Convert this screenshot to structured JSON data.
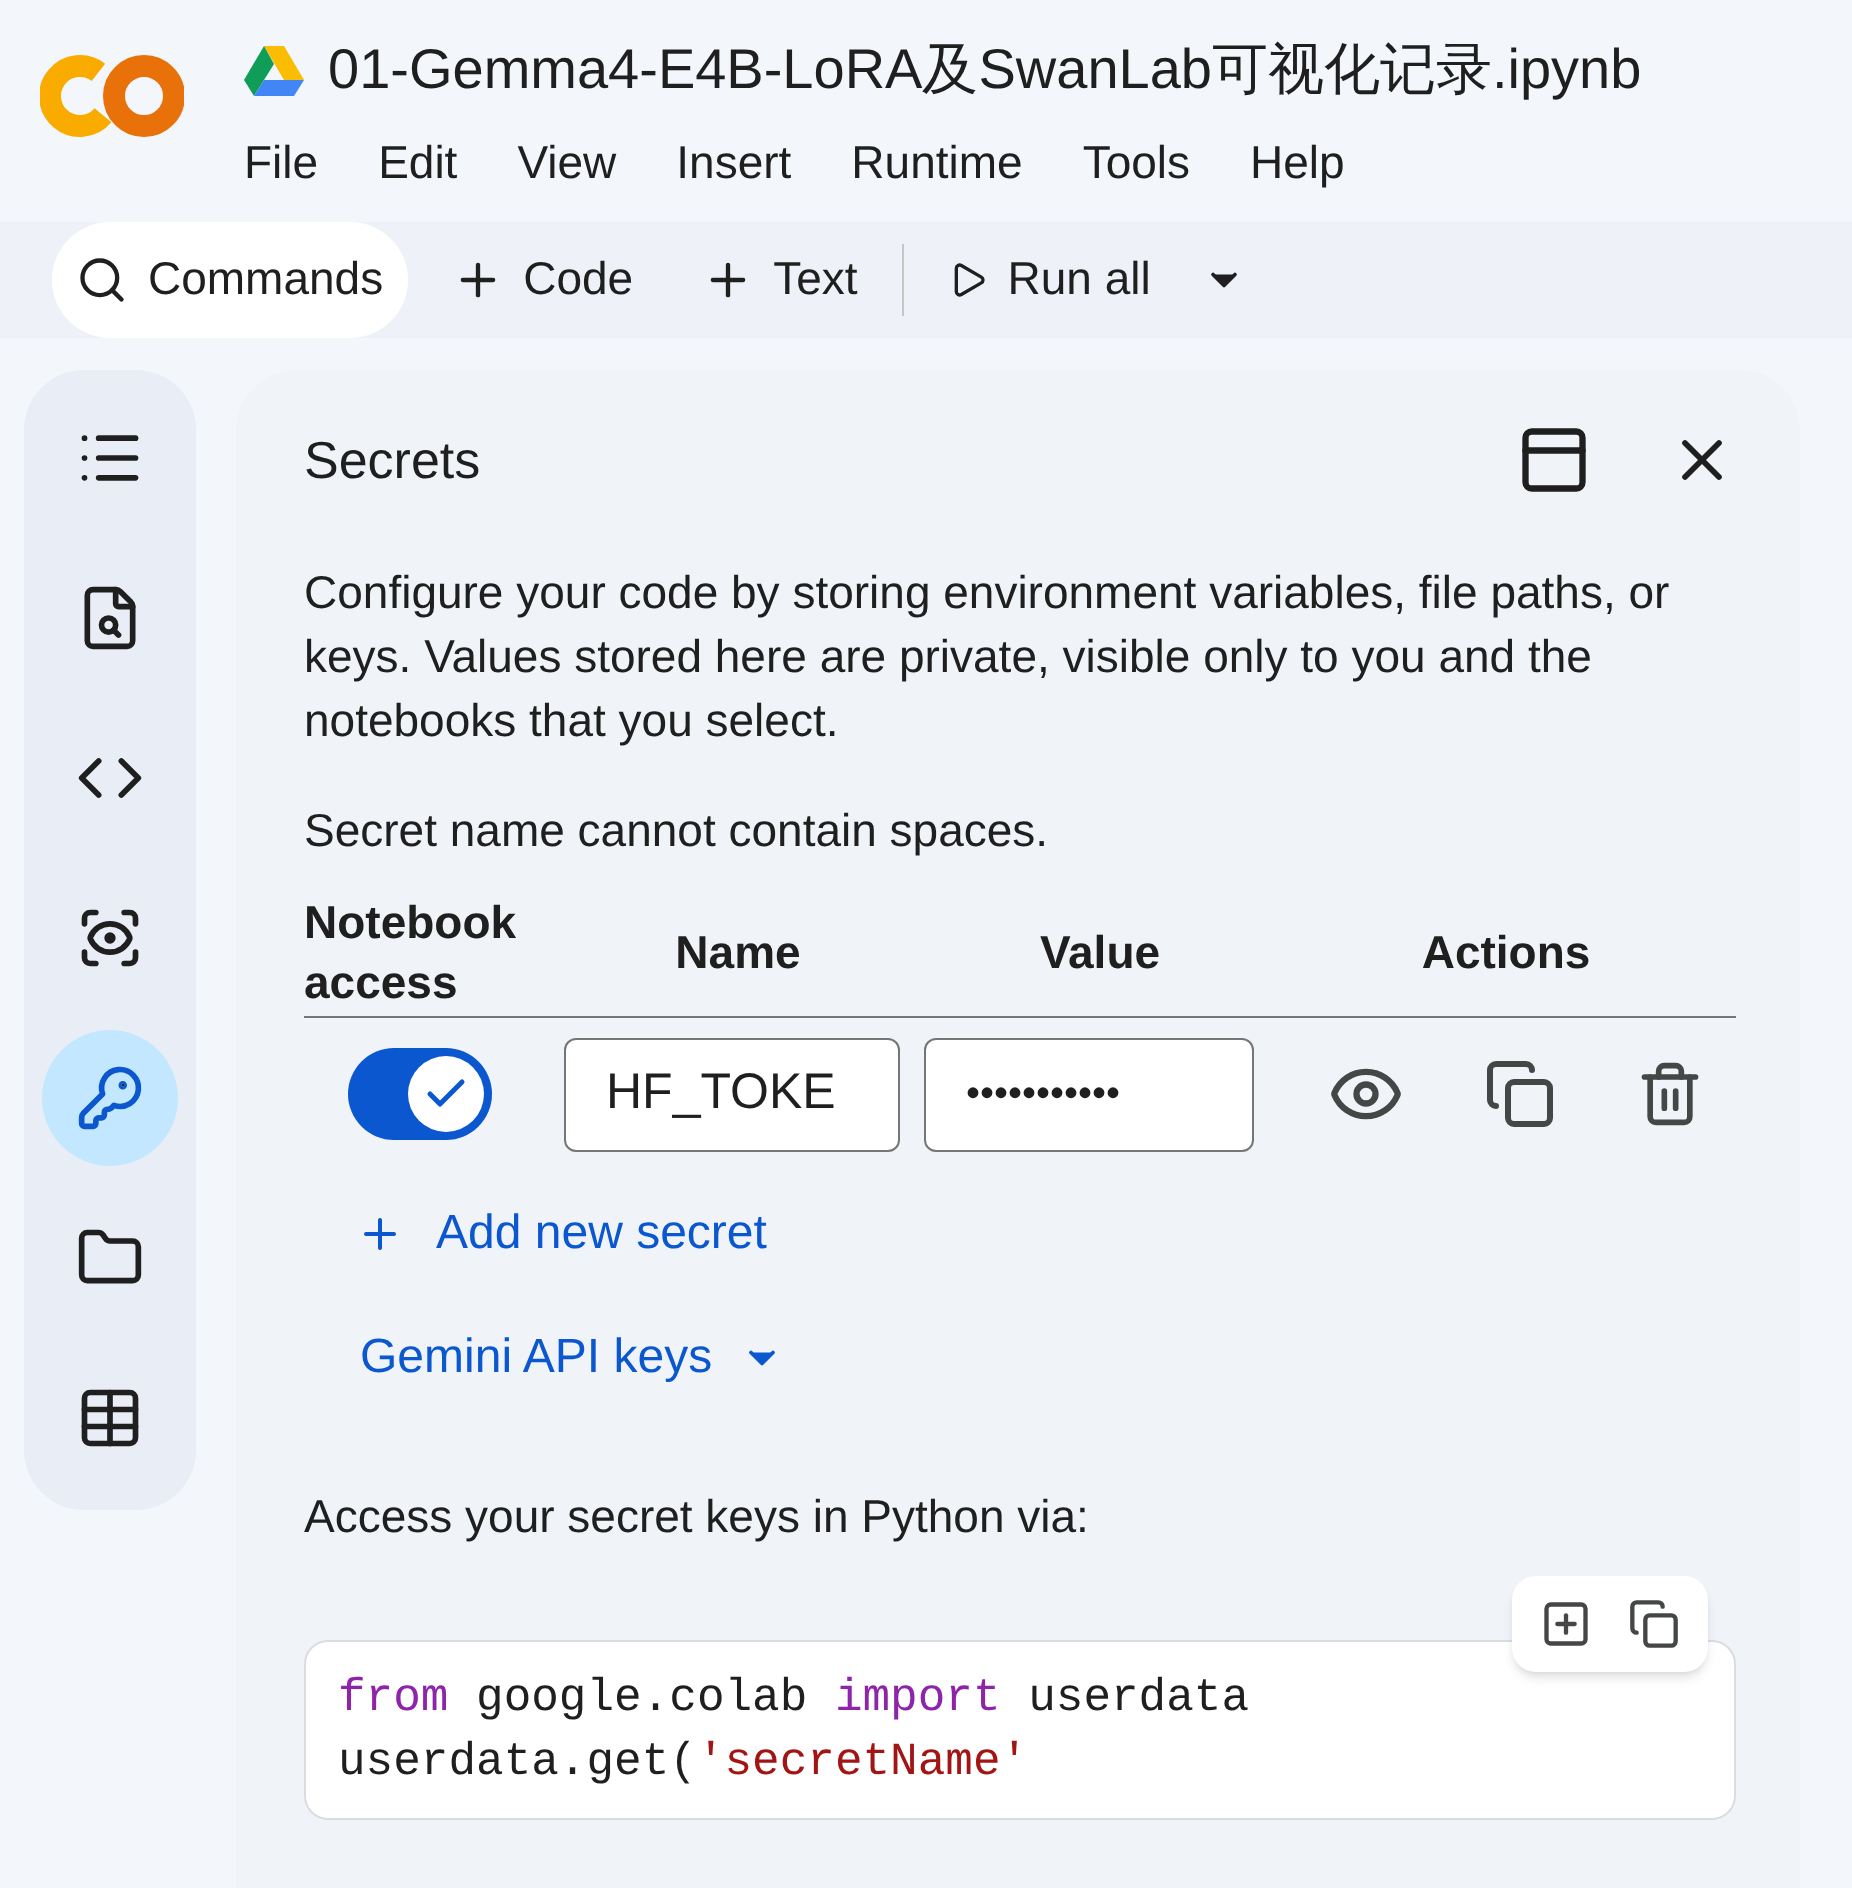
{
  "notebook": {
    "title": "01-Gemma4-E4B-LoRA及SwanLab可视化记录.ipynb"
  },
  "menu": [
    "File",
    "Edit",
    "View",
    "Insert",
    "Runtime",
    "Tools",
    "Help"
  ],
  "toolbar": [
    {
      "kind": "search",
      "label": "Commands"
    },
    {
      "kind": "add",
      "label": "Code"
    },
    {
      "kind": "add",
      "label": "Text"
    },
    {
      "kind": "run",
      "label": "Run all"
    }
  ],
  "sidebar": {
    "items": [
      {
        "kind": "toc",
        "selected": false
      },
      {
        "kind": "find",
        "selected": false
      },
      {
        "kind": "code",
        "selected": false
      },
      {
        "kind": "variables",
        "selected": false
      },
      {
        "kind": "secrets",
        "selected": true
      },
      {
        "kind": "files",
        "selected": false
      },
      {
        "kind": "data",
        "selected": false
      }
    ]
  },
  "panel": {
    "title": "Secrets",
    "description": "Configure your code by storing environment variables, file paths, or keys. Values stored here are private, visible only to you and the notebooks that you select.",
    "note": "Secret name cannot contain spaces.",
    "columns": [
      "Notebook access",
      "Name",
      "Value",
      "Actions"
    ],
    "secrets": [
      {
        "notebook_access": true,
        "name": "HF_TOKE",
        "value": "•••••••••••"
      }
    ],
    "add_button": "Add new secret",
    "gemini_button": "Gemini API keys",
    "access_text": "Access your secret keys in Python via:",
    "code": [
      [
        {
          "kind": "keyword",
          "text": "from"
        },
        {
          "kind": "plain",
          "text": " google.colab "
        },
        {
          "kind": "keyword",
          "text": "import"
        },
        {
          "kind": "plain",
          "text": " userdata"
        }
      ],
      [
        {
          "kind": "plain",
          "text": "userdata.get("
        },
        {
          "kind": "string",
          "text": "'secretName'"
        }
      ]
    ]
  }
}
